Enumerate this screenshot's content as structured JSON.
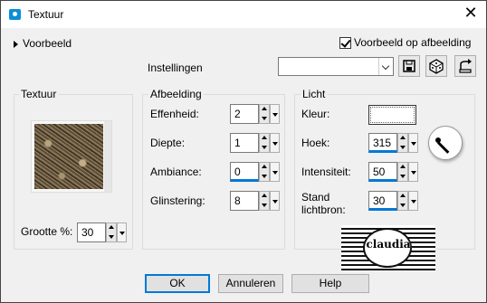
{
  "window": {
    "title": "Textuur",
    "close_label": "✕"
  },
  "preview_toggle": {
    "label": "Voorbeeld"
  },
  "preview_on_image": {
    "label": "Voorbeeld op afbeelding",
    "checked": true
  },
  "settings": {
    "label": "Instellingen",
    "value": ""
  },
  "texture_group": {
    "title": "Textuur",
    "size_label": "Grootte %:",
    "size_value": "30"
  },
  "image_group": {
    "title": "Afbeelding",
    "fields": [
      {
        "label": "Effenheid:",
        "value": "2"
      },
      {
        "label": "Diepte:",
        "value": "1"
      },
      {
        "label": "Ambiance:",
        "value": "0"
      },
      {
        "label": "Glinstering:",
        "value": "8"
      }
    ]
  },
  "light_group": {
    "title": "Licht",
    "color_label": "Kleur:",
    "color_value": "#ffffff",
    "angle_label": "Hoek:",
    "angle_value": "315",
    "intensity_label": "Intensiteit:",
    "intensity_value": "50",
    "position_label_1": "Stand",
    "position_label_2": "lichtbron:",
    "position_value": "30"
  },
  "watermark": {
    "text": "claudia"
  },
  "buttons": {
    "ok": "OK",
    "cancel": "Annuleren",
    "help": "Help"
  }
}
